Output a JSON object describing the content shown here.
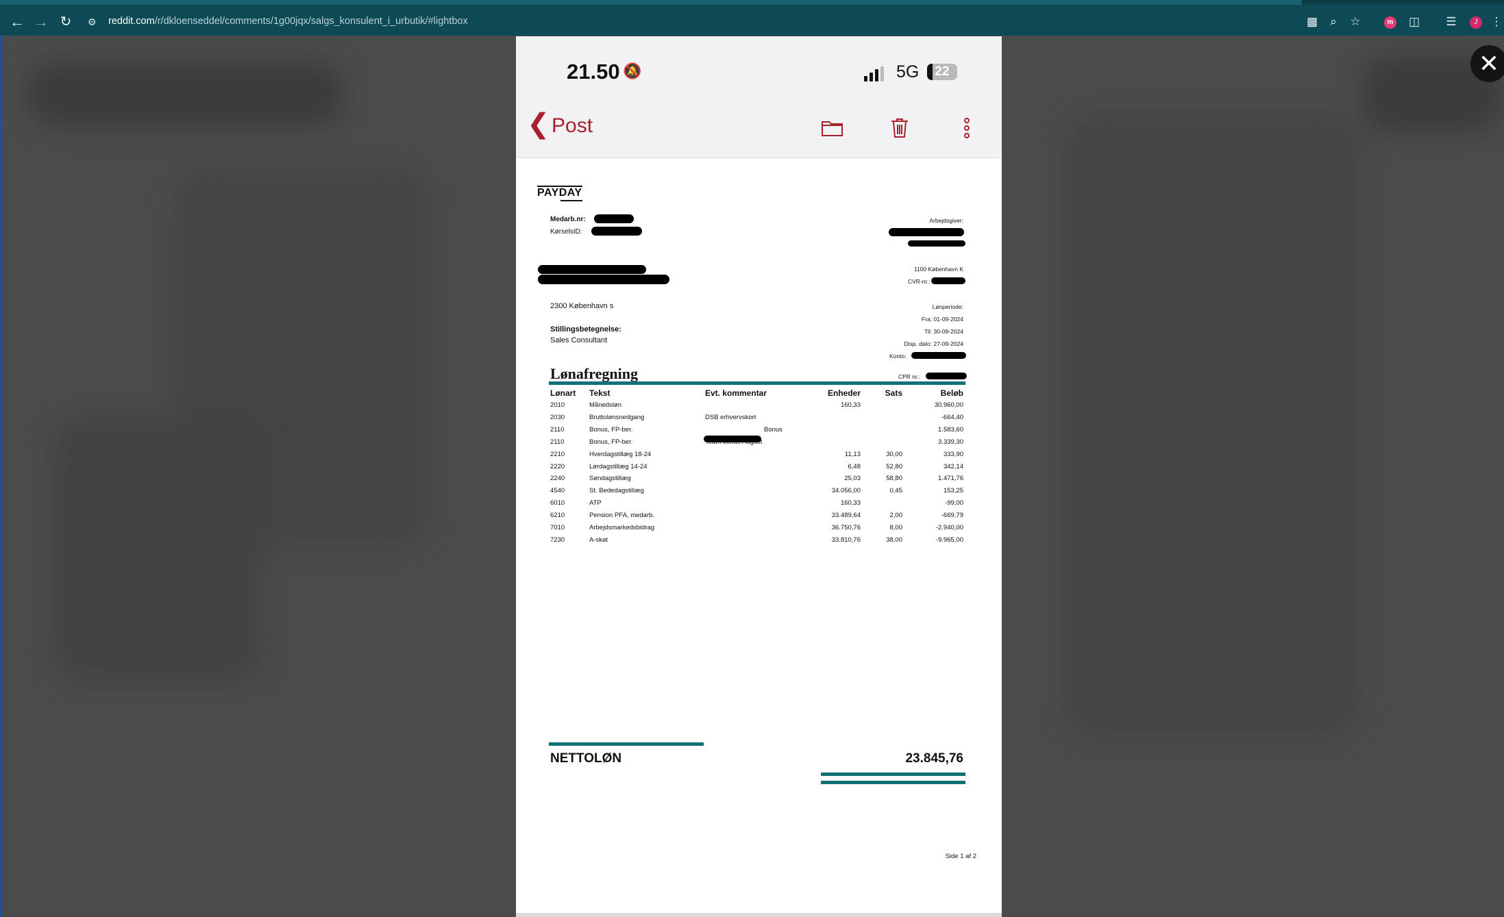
{
  "browser": {
    "url_domain": "reddit.com",
    "url_path": "/r/dkloenseddel/comments/1g00jqx/salgs_konsulent_i_urbutik/#lightbox",
    "back_icon": "arrow-left",
    "forward_icon": "arrow-right",
    "reload_icon": "reload",
    "profile_initial": "J"
  },
  "phone": {
    "time": "21.50",
    "network": "5G",
    "battery": "22",
    "back_label": "Post"
  },
  "payslip": {
    "logo": "PAYDAY",
    "employee_no_label": "Medarb.nr:",
    "driver_id_label": "KørselsID:",
    "employer_label": "Arbejdsgiver:",
    "employer_city": "1100 København K",
    "cvr_label": "CVR-nr.:",
    "employee_city": "2300 København s",
    "period_label": "Lønperiode:",
    "period_from": "Fra: 01-09-2024",
    "period_to": "Til: 30-09-2024",
    "disp_date": "Disp. dato: 27-09-2024",
    "account_label": "Konto:",
    "cpr_label": "CPR nr.:",
    "title_label": "Stillingsbetegnelse:",
    "title_value": "Sales Consultant",
    "heading": "Lønafregning",
    "columns": [
      "Lønart",
      "Tekst",
      "Evt. kommentar",
      "Enheder",
      "Sats",
      "Beløb"
    ],
    "rows": [
      {
        "code": "2010",
        "text": "Månedsløn",
        "comment": "",
        "units": "160,33",
        "rate": "",
        "amount": "30.960,00"
      },
      {
        "code": "2030",
        "text": "Bruttolønsnedgang",
        "comment": "DSB erhvervskort",
        "units": "",
        "rate": "",
        "amount": "-664,40"
      },
      {
        "code": "2110",
        "text": "Bonus, FP-ber.",
        "comment": "Bonus",
        "units": "",
        "rate": "",
        "amount": "1.583,60"
      },
      {
        "code": "2110",
        "text": "Bonus, FP-ber.",
        "comment": "Team bonus August",
        "units": "",
        "rate": "",
        "amount": "3.339,30"
      },
      {
        "code": "2210",
        "text": "Hverdagstillæg 18-24",
        "comment": "",
        "units": "11,13",
        "rate": "30,00",
        "amount": "333,90"
      },
      {
        "code": "2220",
        "text": "Lørdagstillæg 14-24",
        "comment": "",
        "units": "6,48",
        "rate": "52,80",
        "amount": "342,14"
      },
      {
        "code": "2240",
        "text": "Søndagstillæg",
        "comment": "",
        "units": "25,03",
        "rate": "58,80",
        "amount": "1.471,76"
      },
      {
        "code": "4540",
        "text": "St. Bededagstillæg",
        "comment": "",
        "units": "34.056,00",
        "rate": "0,45",
        "amount": "153,25"
      },
      {
        "code": "6010",
        "text": "ATP",
        "comment": "",
        "units": "160,33",
        "rate": "",
        "amount": "-99,00"
      },
      {
        "code": "6210",
        "text": "Pension PFA, medarb.",
        "comment": "",
        "units": "33.489,64",
        "rate": "2,00",
        "amount": "-669,79"
      },
      {
        "code": "7010",
        "text": "Arbejdsmarkedsbidrag",
        "comment": "",
        "units": "36.750,76",
        "rate": "8,00",
        "amount": "-2.940,00"
      },
      {
        "code": "7230",
        "text": "A-skat",
        "comment": "",
        "units": "33.810,76",
        "rate": "38,00",
        "amount": "-9.965,00"
      }
    ],
    "net_label": "NETTOLØN",
    "net_value": "23.845,76",
    "page": "Side 1 af 2"
  },
  "colors": {
    "chrome": "#0e4a55",
    "accent_red": "#a8202c",
    "rule_teal": "#136f78"
  }
}
